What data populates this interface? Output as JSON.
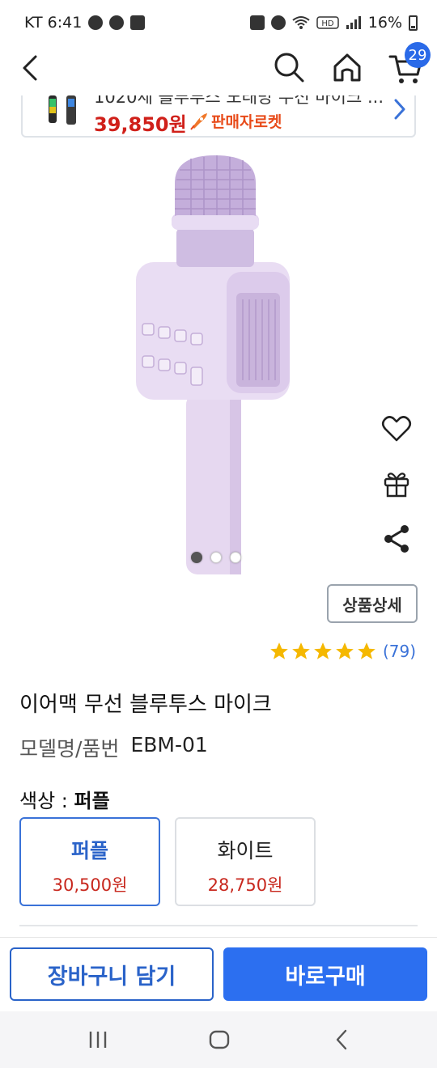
{
  "status_bar": {
    "carrier_time": "KT 6:41",
    "battery": "16%",
    "left_icons": [
      "talk-icon",
      "game-icon",
      "pay-icon"
    ],
    "right_icons": [
      "app-icon",
      "alarm-icon",
      "wifi-icon",
      "hd-icon",
      "signal-icon",
      "battery-icon"
    ]
  },
  "nav": {
    "cart_count": "29"
  },
  "banner": {
    "title": "1020세 블루투스 노래방 무선 마이크 ...",
    "price": "39,850원",
    "badge": "판매자로켓"
  },
  "gallery": {
    "dots": 3,
    "active_index": 0
  },
  "detail_button": "상품상세",
  "rating": {
    "stars": 5,
    "count": "(79)"
  },
  "product": {
    "title": "이어맥 무선 블루투스 마이크",
    "model_label": "모델명/품번",
    "model_value": "EBM-01",
    "color_label": "색상 : ",
    "color_selected": "퍼플"
  },
  "options": [
    {
      "name": "퍼플",
      "price": "30,500원",
      "selected": true
    },
    {
      "name": "화이트",
      "price": "28,750원",
      "selected": false
    }
  ],
  "cta": {
    "cart": "장바구니 담기",
    "buy": "바로구매"
  },
  "colors": {
    "accent_blue": "#2c6ff0",
    "price_red": "#c8281e",
    "star_yellow": "#f5b800",
    "product_lavender": "#e3d4ef"
  }
}
